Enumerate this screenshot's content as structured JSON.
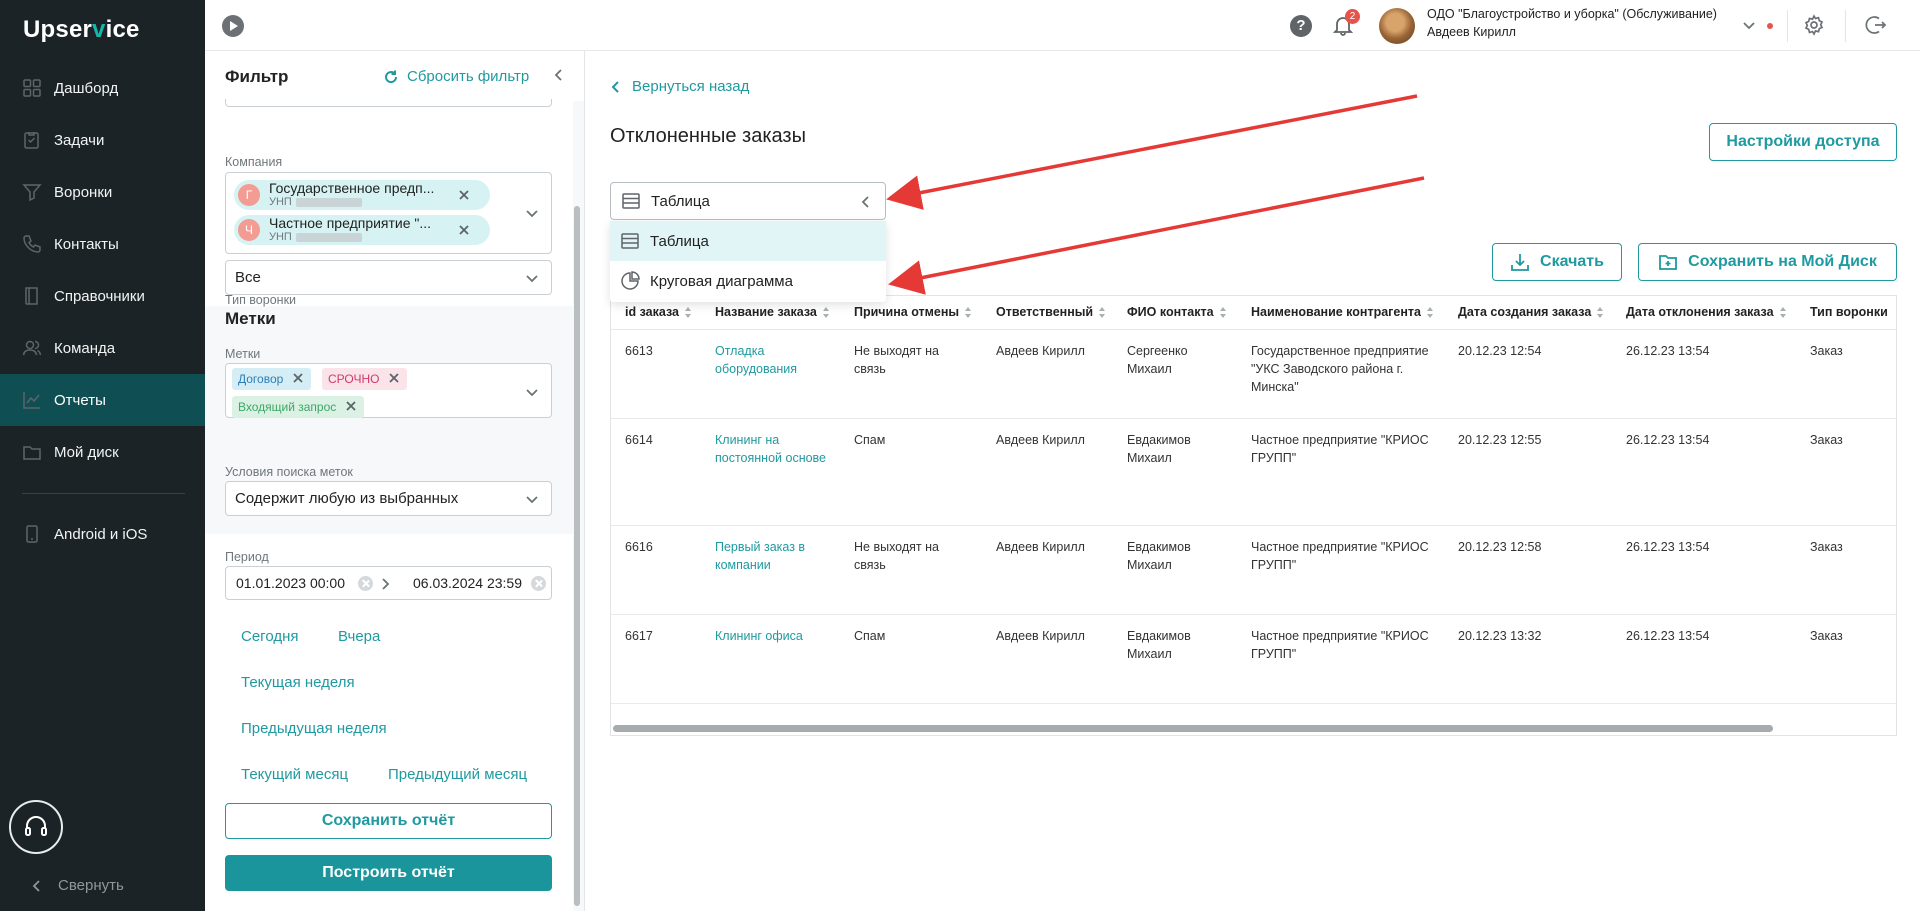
{
  "nav": {
    "logo_a": "Upser",
    "logo_check": "v",
    "logo_b": "ice",
    "items": [
      {
        "label": "Дашборд",
        "icon": "dashboard-icon"
      },
      {
        "label": "Задачи",
        "icon": "tasks-icon"
      },
      {
        "label": "Воронки",
        "icon": "funnel-icon"
      },
      {
        "label": "Контакты",
        "icon": "phone-icon"
      },
      {
        "label": "Справочники",
        "icon": "book-icon"
      },
      {
        "label": "Команда",
        "icon": "team-icon"
      },
      {
        "label": "Отчеты",
        "icon": "chart-icon",
        "active": true
      },
      {
        "label": "Мой диск",
        "icon": "folder-icon"
      }
    ],
    "mobile_label": "Android и iOS",
    "collapse_label": "Свернуть"
  },
  "topbar": {
    "notifications_count": "2",
    "help_label": "?",
    "org_name": "ОДО \"Благоустройство и уборка\" (Обслуживание)",
    "user_name": "Авдеев Кирилл"
  },
  "filter": {
    "title": "Фильтр",
    "reset_label": "Сбросить фильтр",
    "company_label": "Компания",
    "companies": [
      {
        "letter": "Г",
        "name": "Государственное предп...",
        "sub": "УНП"
      },
      {
        "letter": "Ч",
        "name": "Частное предприятие \"...",
        "sub": "УНП"
      }
    ],
    "funnel_type_label": "Тип воронки",
    "funnel_type_value": "Все",
    "tags_section": "Метки",
    "tags_label": "Метки",
    "tags": [
      "Договор",
      "СРОЧНО",
      "Входящий запрос"
    ],
    "tag_condition_label": "Условия поиска меток",
    "tag_condition_value": "Содержит любую из выбранных",
    "period_label": "Период",
    "date_from": "01.01.2023 00:00",
    "date_to": "06.03.2024 23:59",
    "quick_periods": {
      "today": "Сегодня",
      "yesterday": "Вчера",
      "this_week": "Текущая неделя",
      "prev_week": "Предыдущая неделя",
      "this_month": "Текущий месяц",
      "prev_month": "Предыдущий месяц"
    },
    "save_report": "Сохранить отчёт",
    "build_report": "Построить отчёт"
  },
  "main": {
    "back_label": "Вернуться назад",
    "title": "Отклоненные заказы",
    "access_button": "Настройки доступа",
    "view_selected": "Таблица",
    "view_options": [
      "Таблица",
      "Круговая диаграмма"
    ],
    "download_button": "Скачать",
    "save_disk_button": "Сохранить на Мой Диск"
  },
  "table": {
    "columns": [
      "id заказа",
      "Название заказа",
      "Причина отмены",
      "Ответственный",
      "ФИО контакта",
      "Наименование контрагента",
      "Дата создания заказа",
      "Дата отклонения заказа",
      "Тип воронки"
    ],
    "rows": [
      [
        "6613",
        "Отладка оборудования",
        "Не выходят на связь",
        "Авдеев Кирилл",
        "Сергеенко Михаил",
        "Государственное предприятие \"УКС Заводского района г. Минска\"",
        "20.12.23 12:54",
        "26.12.23 13:54",
        "Заказ"
      ],
      [
        "6614",
        "Клининг на постоянной основе",
        "Спам",
        "Авдеев Кирилл",
        "Евдакимов Михаил",
        "Частное предприятие \"КРИОС ГРУПП\"",
        "20.12.23 12:55",
        "26.12.23 13:54",
        "Заказ"
      ],
      [
        "6616",
        "Первый заказ в компании",
        "Не выходят на связь",
        "Авдеев Кирилл",
        "Евдакимов Михаил",
        "Частное предприятие \"КРИОС ГРУПП\"",
        "20.12.23 12:58",
        "26.12.23 13:54",
        "Заказ"
      ],
      [
        "6617",
        "Клининг офиса",
        "Спам",
        "Авдеев Кирилл",
        "Евдакимов Михаил",
        "Частное предприятие \"КРИОС ГРУПП\"",
        "20.12.23 13:32",
        "26.12.23 13:54",
        "Заказ"
      ]
    ]
  },
  "colors": {
    "accent": "#1f9aa0",
    "nav_bg": "#1c2326",
    "nav_active": "#0f4f53",
    "annotation_arrow": "#e53935"
  }
}
